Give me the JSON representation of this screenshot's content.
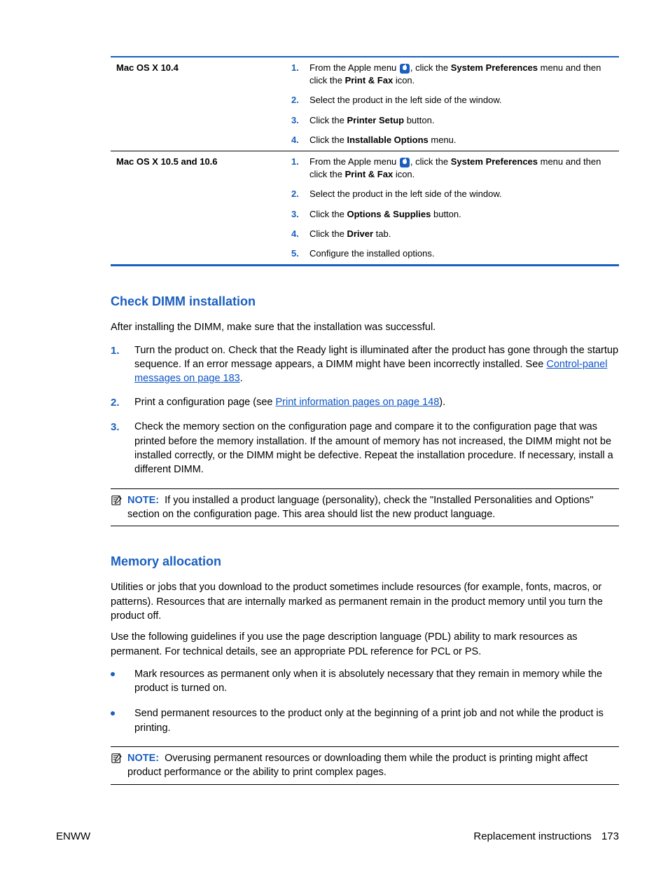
{
  "table": {
    "rows": [
      {
        "os": "Mac OS X 10.4",
        "steps": [
          {
            "num": "1.",
            "parts": [
              "From the Apple menu ",
              "APPLE",
              ", click the ",
              "B:System Preferences",
              " menu and then click the ",
              "B:Print & Fax",
              " icon."
            ]
          },
          {
            "num": "2.",
            "parts": [
              "Select the product in the left side of the window."
            ]
          },
          {
            "num": "3.",
            "parts": [
              "Click the ",
              "B:Printer Setup",
              " button."
            ]
          },
          {
            "num": "4.",
            "parts": [
              "Click the ",
              "B:Installable Options",
              " menu."
            ]
          }
        ]
      },
      {
        "os": "Mac OS X 10.5 and 10.6",
        "steps": [
          {
            "num": "1.",
            "parts": [
              "From the Apple menu ",
              "APPLE",
              ", click the ",
              "B:System Preferences",
              " menu and then click the ",
              "B:Print & Fax",
              " icon."
            ]
          },
          {
            "num": "2.",
            "parts": [
              "Select the product in the left side of the window."
            ]
          },
          {
            "num": "3.",
            "parts": [
              "Click the ",
              "B:Options & Supplies",
              " button."
            ]
          },
          {
            "num": "4.",
            "parts": [
              "Click the ",
              "B:Driver",
              " tab."
            ]
          },
          {
            "num": "5.",
            "parts": [
              "Configure the installed options."
            ]
          }
        ]
      }
    ]
  },
  "section1": {
    "heading": "Check DIMM installation",
    "intro": "After installing the DIMM, make sure that the installation was successful.",
    "steps": [
      {
        "num": "1.",
        "pre": "Turn the product on. Check that the Ready light is illuminated after the product has gone through the startup sequence. If an error message appears, a DIMM might have been incorrectly installed. See ",
        "link": "Control-panel messages on page 183",
        "post": "."
      },
      {
        "num": "2.",
        "pre": "Print a configuration page (see ",
        "link": "Print information pages on page 148",
        "post": ")."
      },
      {
        "num": "3.",
        "pre": "Check the memory section on the configuration page and compare it to the configuration page that was printed before the memory installation. If the amount of memory has not increased, the DIMM might not be installed correctly, or the DIMM might be defective. Repeat the installation procedure. If necessary, install a different DIMM.",
        "link": "",
        "post": ""
      }
    ],
    "note_label": "NOTE:",
    "note_text": "If you installed a product language (personality), check the \"Installed Personalities and Options\" section on the configuration page. This area should list the new product language."
  },
  "section2": {
    "heading": "Memory allocation",
    "p1": "Utilities or jobs that you download to the product sometimes include resources (for example, fonts, macros, or patterns). Resources that are internally marked as permanent remain in the product memory until you turn the product off.",
    "p2": "Use the following guidelines if you use the page description language (PDL) ability to mark resources as permanent. For technical details, see an appropriate PDL reference for PCL or PS.",
    "bullets": [
      "Mark resources as permanent only when it is absolutely necessary that they remain in memory while the product is turned on.",
      "Send permanent resources to the product only at the beginning of a print job and not while the product is printing."
    ],
    "note_label": "NOTE:",
    "note_text": "Overusing permanent resources or downloading them while the product is printing might affect product performance or the ability to print complex pages."
  },
  "footer": {
    "left": "ENWW",
    "right": "Replacement instructions",
    "page": "173"
  }
}
